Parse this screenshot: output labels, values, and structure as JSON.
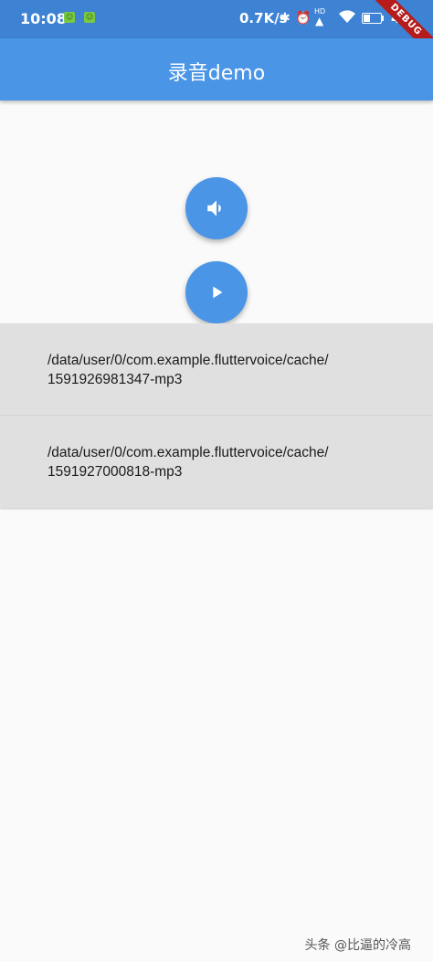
{
  "status_bar": {
    "time": "10:08",
    "network_speed": "0.7K/s",
    "bluetooth_icon": "bluetooth-icon",
    "alarm_icon": "alarm-icon",
    "hd_label": "HD",
    "wifi_icon": "wifi-icon",
    "battery_percent": "43",
    "battery_level": 0.43,
    "notification_icons": [
      "app-notification-icon",
      "app-notification-icon"
    ]
  },
  "debug_banner": "DEBUG",
  "app_bar": {
    "title": "录音demo",
    "color": "#4a95e6"
  },
  "buttons": {
    "record": {
      "icon": "volume-icon"
    },
    "play": {
      "icon": "play-icon"
    }
  },
  "recordings": [
    {
      "path": "/data/user/0/com.example.fluttervoice/cache/\n1591926981347-mp3"
    },
    {
      "path": "/data/user/0/com.example.fluttervoice/cache/\n1591927000818-mp3"
    }
  ],
  "watermark": "头条 @比逼的冷高"
}
